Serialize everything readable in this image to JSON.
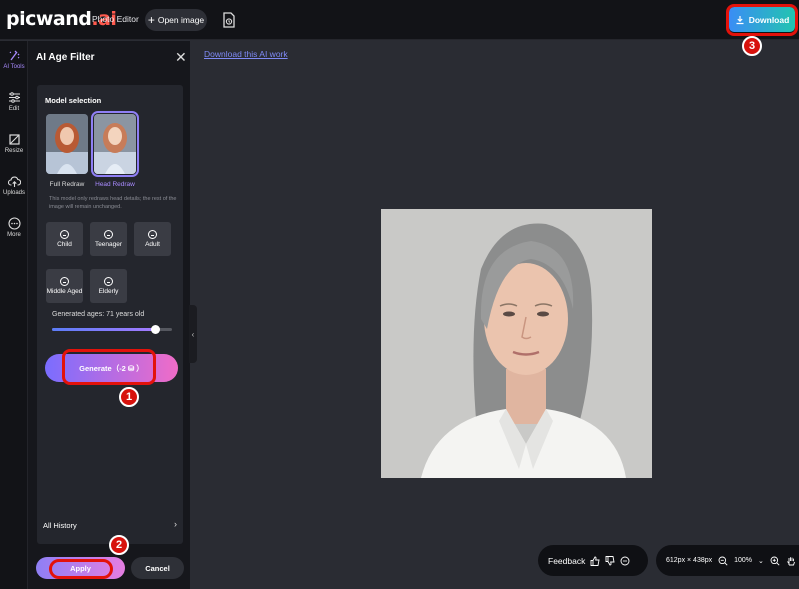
{
  "topbar": {
    "logo_main": "picwand",
    "logo_suffix": ".ai",
    "nav_photo_editor": "Photo Editor",
    "open_image": "Open image",
    "download": "Download"
  },
  "rail": [
    {
      "label": "AI Tools",
      "icon": "magic-pen-icon",
      "active": true
    },
    {
      "label": "Edit",
      "icon": "sliders-icon"
    },
    {
      "label": "Resize",
      "icon": "crop-icon"
    },
    {
      "label": "Uploads",
      "icon": "upload-cloud-icon"
    },
    {
      "label": "More",
      "icon": "more-dots-icon"
    }
  ],
  "panel": {
    "title": "AI Age Filter",
    "model_selection": "Model selection",
    "models": [
      {
        "label": "Full Redraw",
        "selected": false
      },
      {
        "label": "Head Redraw",
        "selected": true
      }
    ],
    "description": "This model only redraws head details; the rest of the image will remain unchanged.",
    "age_options": [
      "Child",
      "Teenager",
      "Adult",
      "Middle Aged",
      "Elderly"
    ],
    "generated_label": "Generated ages: 71 years old",
    "slider_value": 0.86,
    "generate": "Generate（-2 ⛁ ）",
    "history": "All History",
    "apply": "Apply",
    "cancel": "Cancel"
  },
  "canvas": {
    "download_link": "Download this AI work",
    "feedback": "Feedback",
    "dimensions": "612px × 438px",
    "zoom": "100%"
  },
  "annotations": {
    "markers": [
      "1",
      "2",
      "3"
    ],
    "highlight_color": "#e3120b"
  },
  "colors": {
    "accent_purple": "#8f7ff5",
    "accent_pink": "#f06cc7",
    "download_blue": "#3a8df5",
    "download_teal": "#22c4b0",
    "link_color": "#7f8af6"
  }
}
